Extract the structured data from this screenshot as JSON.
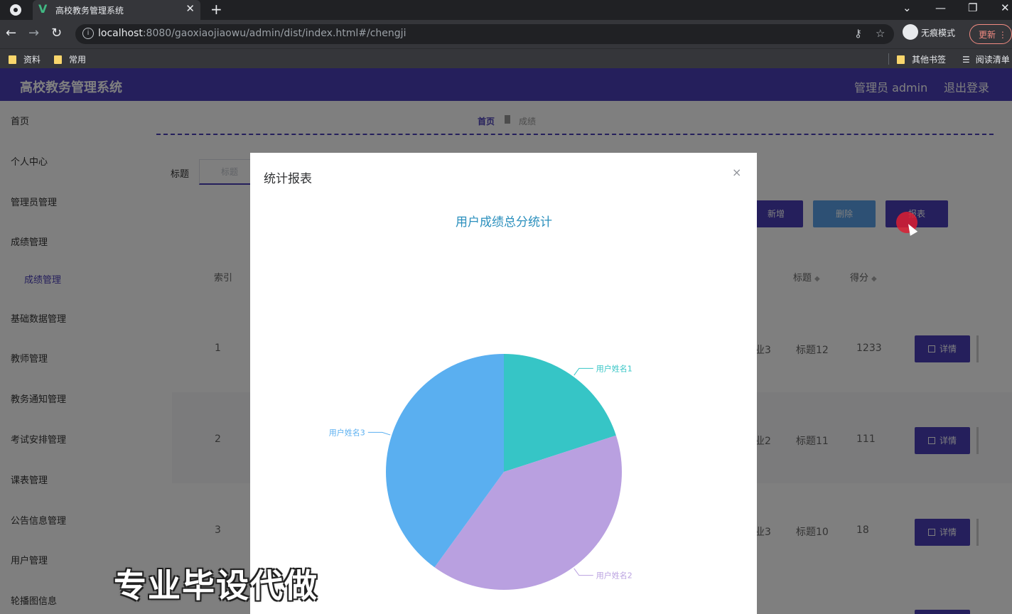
{
  "browser": {
    "tab_title": "高校教务管理系统",
    "url_host": "localhost",
    "url_rest": ":8080/gaoxiaojiaowu/admin/dist/index.html#/chengji",
    "incognito_label": "无痕模式",
    "update_label": "更新",
    "bookmarks": [
      "资料",
      "常用"
    ],
    "bookmarks_right": [
      "其他书签",
      "阅读清单"
    ]
  },
  "app": {
    "title": "高校教务管理系统",
    "user": "管理员 admin",
    "logout": "退出登录"
  },
  "sidebar": {
    "items": [
      "首页",
      "个人中心",
      "管理员管理",
      "成绩管理",
      "成绩管理",
      "基础数据管理",
      "教师管理",
      "教务通知管理",
      "考试安排管理",
      "课表管理",
      "公告信息管理",
      "用户管理",
      "轮播图信息"
    ]
  },
  "breadcrumb": {
    "home": "首页",
    "current": "成绩"
  },
  "filter": {
    "label": "标题",
    "placeholder": "标题"
  },
  "actions": {
    "add": "新增",
    "delete": "删除",
    "report": "报表"
  },
  "table": {
    "headers": [
      "索引",
      "标题",
      "得分"
    ],
    "rows": [
      {
        "index": "1",
        "col": "业3",
        "title": "标题12",
        "score": "1233",
        "detail": "详情"
      },
      {
        "index": "2",
        "col": "业2",
        "title": "标题11",
        "score": "111",
        "detail": "详情"
      },
      {
        "index": "3",
        "col": "业3",
        "title": "标题10",
        "score": "18",
        "detail": "详情"
      }
    ]
  },
  "modal": {
    "title": "统计报表",
    "close": "×"
  },
  "chart_data": {
    "type": "pie",
    "title": "用户成绩总分统计",
    "categories": [
      "用户姓名1",
      "用户姓名2",
      "用户姓名3"
    ],
    "values": [
      0.2,
      0.4,
      0.4
    ],
    "colors": [
      "#36c5c6",
      "#b9a0e0",
      "#5aaff0"
    ]
  },
  "watermark": "专业毕设代做"
}
